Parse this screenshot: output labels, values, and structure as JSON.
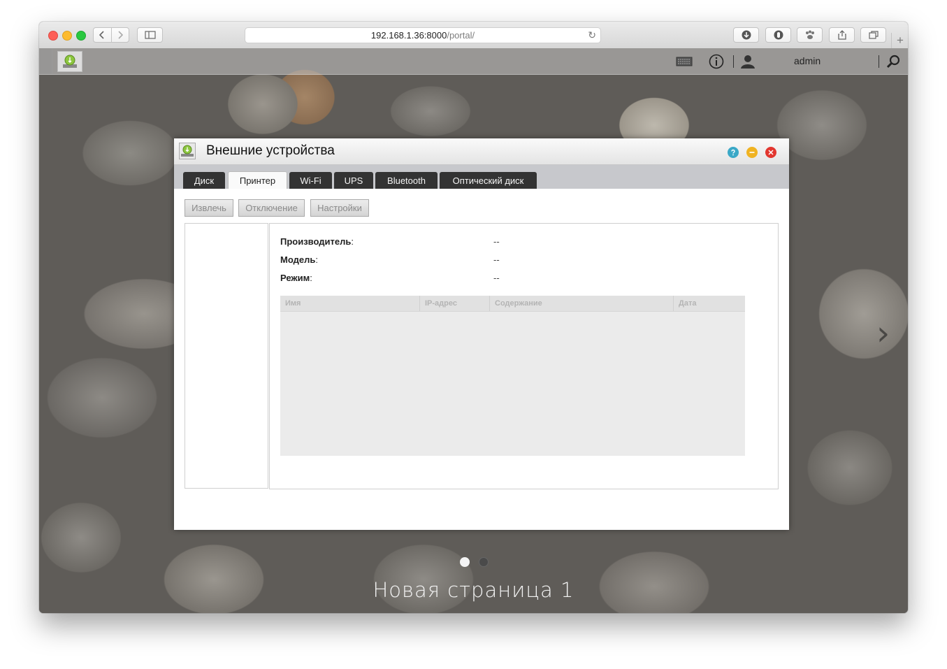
{
  "browser": {
    "url_host": "192.168.1.36:8000",
    "url_path": "/portal/",
    "reload_glyph": "↻",
    "new_tab_glyph": "+",
    "icons": [
      "back-icon",
      "forward-icon",
      "sidebar-icon",
      "downloads-icon",
      "extension-icon",
      "paw-extension-icon",
      "share-icon",
      "tabs-overview-icon"
    ]
  },
  "portal": {
    "username": "admin",
    "icons": [
      "app-launcher-icon",
      "keyboard-icon",
      "info-icon",
      "user-icon",
      "search-icon"
    ],
    "next_page_glyph": "›",
    "page_label": "Новая страница 1",
    "page_dots": [
      {
        "active": true
      },
      {
        "active": false
      }
    ]
  },
  "dialog": {
    "title": "Внешние устройства",
    "tabs": [
      {
        "label": "Диск",
        "active": false
      },
      {
        "label": "Принтер",
        "active": true
      },
      {
        "label": "Wi-Fi",
        "active": false
      },
      {
        "label": "UPS",
        "active": false
      },
      {
        "label": "Bluetooth",
        "active": false
      },
      {
        "label": "Оптический диск",
        "active": false
      }
    ],
    "actions": {
      "eject": "Извлечь",
      "disconnect": "Отключение",
      "settings": "Настройки"
    },
    "info": [
      {
        "label": "Производитель",
        "value": "--"
      },
      {
        "label": "Модель",
        "value": "--"
      },
      {
        "label": "Режим",
        "value": "--"
      }
    ],
    "table": {
      "columns": [
        "Имя",
        "IP-адрес",
        "Содержание",
        "Дата"
      ],
      "rows": []
    },
    "colors": {
      "help": "#3aa8c7",
      "minimize": "#f0b322",
      "close": "#e2362f",
      "tab_dark": "#333333"
    }
  }
}
